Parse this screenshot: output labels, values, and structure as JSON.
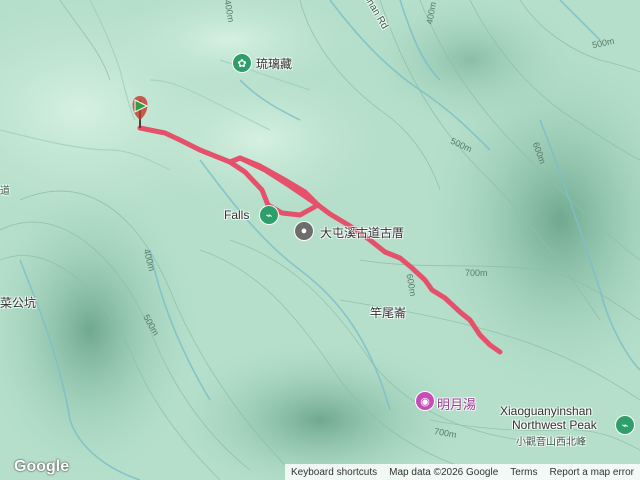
{
  "map": {
    "labels": {
      "liulicang": "琉璃藏",
      "falls": "Falls",
      "trail_name": "大屯溪古道古厝",
      "ganweiliao": "竿尾崙",
      "mingyuetang": "明月湯",
      "peak_en_1": "Xiaoguanyinshan",
      "peak_en_2": "Northwest Peak",
      "peak_zh": "小觀音山西北峰",
      "caigongkeng": "菜公坑",
      "road": "Shan Rd",
      "dao": "道",
      "c400_top": "400m",
      "c400_right": "400m",
      "c500_a": "500m",
      "c500_b": "500m",
      "c600_a": "600m",
      "c600_b": "600m",
      "c700_a": "700m",
      "c700_b": "700m",
      "c400_left": "400m",
      "c500_left": "500m"
    }
  },
  "footer": {
    "logo": "Google",
    "keyboard": "Keyboard shortcuts",
    "mapdata": "Map data ©2026 Google",
    "terms": "Terms",
    "report": "Report a map error"
  },
  "colors": {
    "route": "#e5506a",
    "terrain_light": "#c6e8d6",
    "terrain_dark": "#7fb8a0",
    "start_marker": "#2e9e47"
  },
  "icons": [
    "flower-icon",
    "park-icon",
    "pin-icon",
    "camera-icon",
    "start-marker-icon"
  ]
}
